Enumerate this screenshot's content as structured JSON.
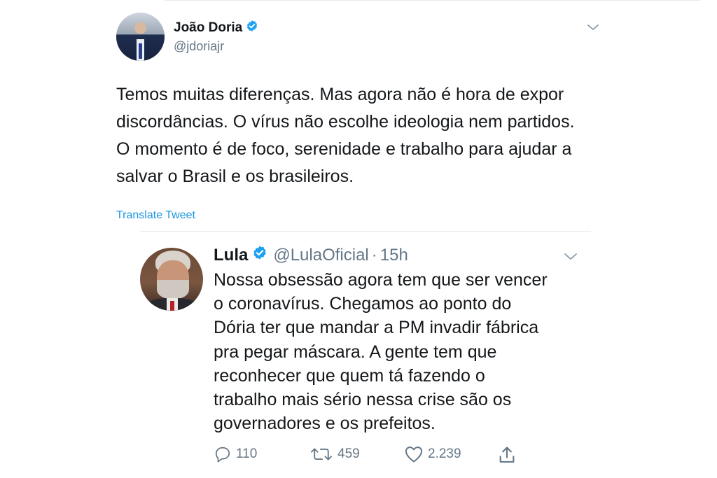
{
  "main_tweet": {
    "name": "João Doria",
    "handle": "@jdoriajr",
    "text": "Temos muitas diferenças. Mas agora não é hora de expor\ndiscordâncias. O vírus não escolhe ideologia nem partidos.\nO momento é de foco, serenidade e trabalho para ajudar a\nsalvar o Brasil e os brasileiros.",
    "translate_label": "Translate Tweet",
    "icons": {
      "verified": "verified-badge-icon",
      "menu": "chevron-down-icon"
    }
  },
  "reply_tweet": {
    "name": "Lula",
    "handle": "@LulaOficial",
    "separator": "·",
    "time": "15h",
    "text": "Nossa obsessão agora tem que ser vencer\no coronavírus. Chegamos ao ponto do\nDória ter que mandar a PM invadir fábrica\npra pegar máscara. A gente tem que\nreconhecer que quem tá fazendo o\ntrabalho mais sério nessa crise são os\ngovernadores e os prefeitos.",
    "actions": {
      "replies": "110",
      "retweets": "459",
      "likes": "2.239"
    },
    "icons": {
      "reply": "reply-icon",
      "retweet": "retweet-icon",
      "like": "heart-icon",
      "share": "share-icon"
    }
  },
  "colors": {
    "text": "#14171a",
    "secondary": "#657786",
    "accent": "#1b95e0",
    "verified": "#1da1f2",
    "divider": "#e6ecf0"
  }
}
